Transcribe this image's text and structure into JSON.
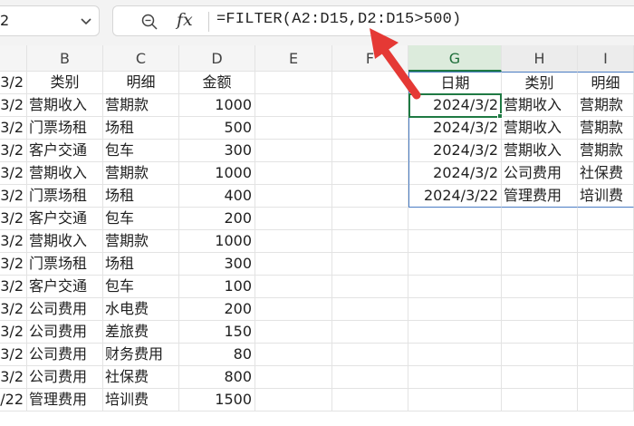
{
  "namebox": {
    "value": "2"
  },
  "formula_bar": {
    "fx_label": "fx",
    "formula": "=FILTER(A2:D15,D2:D15>500)"
  },
  "columns": [
    "B",
    "C",
    "D",
    "E",
    "F",
    "G",
    "H",
    "I"
  ],
  "header_row": {
    "a": "3/2",
    "b": "类别",
    "c": "明细",
    "d": "金额"
  },
  "rows": [
    {
      "a": "3/2",
      "b": "营期收入",
      "c": "营期款",
      "d": "1000"
    },
    {
      "a": "3/2",
      "b": "门票场租",
      "c": "场租",
      "d": "500"
    },
    {
      "a": "3/2",
      "b": "客户交通",
      "c": "包车",
      "d": "300"
    },
    {
      "a": "3/2",
      "b": "营期收入",
      "c": "营期款",
      "d": "1000"
    },
    {
      "a": "3/2",
      "b": "门票场租",
      "c": "场租",
      "d": "400"
    },
    {
      "a": "3/2",
      "b": "客户交通",
      "c": "包车",
      "d": "200"
    },
    {
      "a": "3/2",
      "b": "营期收入",
      "c": "营期款",
      "d": "1000"
    },
    {
      "a": "3/2",
      "b": "门票场租",
      "c": "场租",
      "d": "300"
    },
    {
      "a": "3/2",
      "b": "客户交通",
      "c": "包车",
      "d": "100"
    },
    {
      "a": "3/2",
      "b": "公司费用",
      "c": "水电费",
      "d": "200"
    },
    {
      "a": "3/2",
      "b": "公司费用",
      "c": "差旅费",
      "d": "150"
    },
    {
      "a": "3/2",
      "b": "公司费用",
      "c": "财务费用",
      "d": "80"
    },
    {
      "a": "3/2",
      "b": "公司费用",
      "c": "社保费",
      "d": "800"
    },
    {
      "a": "/22",
      "b": "管理费用",
      "c": "培训费",
      "d": "1500"
    }
  ],
  "result_headers": {
    "g": "日期",
    "h": "类别",
    "i": "明细"
  },
  "result_rows": [
    {
      "g": "2024/3/2",
      "h": "营期收入",
      "i": "营期款"
    },
    {
      "g": "2024/3/2",
      "h": "营期收入",
      "i": "营期款"
    },
    {
      "g": "2024/3/2",
      "h": "营期收入",
      "i": "营期款"
    },
    {
      "g": "2024/3/2",
      "h": "公司费用",
      "i": "社保费"
    },
    {
      "g": "2024/3/22",
      "h": "管理费用",
      "i": "培训费"
    }
  ],
  "colors": {
    "selection": "#1f7a43",
    "spill_border": "#4a7cc3",
    "arrow": "#e53935"
  }
}
